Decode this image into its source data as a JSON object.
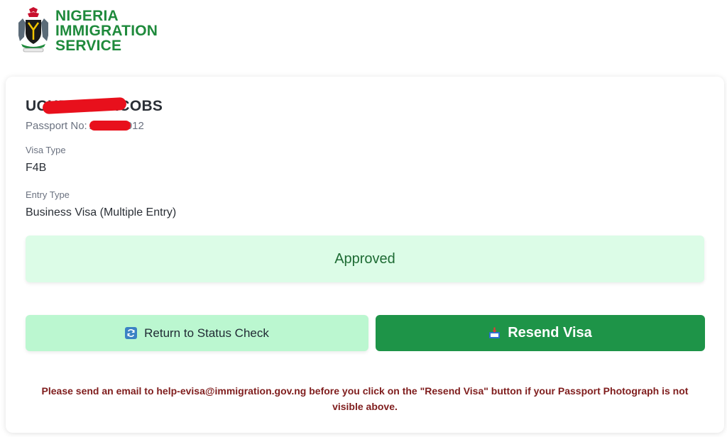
{
  "brand": {
    "line1": "NIGERIA",
    "line2": "IMMIGRATION",
    "line3": "SERVICE",
    "color": "#1f8a3c"
  },
  "applicant": {
    "name": "UCHENDI JACOBS",
    "passport_label": "Passport No:",
    "passport_number": "A03556012"
  },
  "fields": {
    "visa_type_label": "Visa Type",
    "visa_type_value": "F4B",
    "entry_type_label": "Entry Type",
    "entry_type_value": "Business Visa (Multiple Entry)"
  },
  "status": {
    "label": "Approved",
    "bg_color": "#dcfce7",
    "text_color": "#1e6b34"
  },
  "buttons": {
    "return_label": "Return to Status Check",
    "return_icon": "refresh-icon",
    "resend_label": "Resend Visa",
    "resend_icon": "inbox-tray-icon",
    "resend_color": "#1e9448"
  },
  "notice": {
    "text": "Please send an email to help-evisa@immigration.gov.ng before you click on the \"Resend Visa\" button if your Passport Photograph is not visible above."
  }
}
